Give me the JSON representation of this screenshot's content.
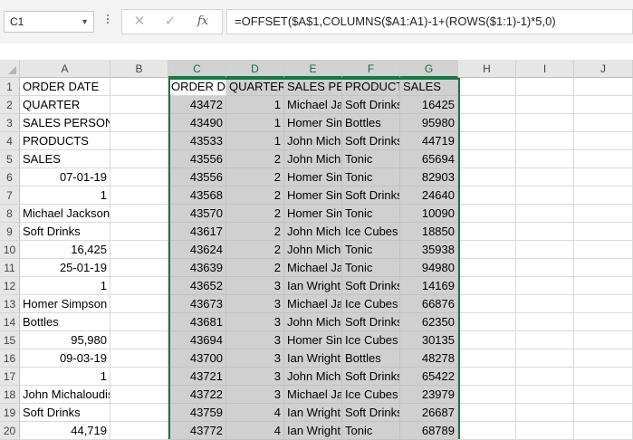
{
  "name_box": {
    "value": "C1"
  },
  "formula_bar": {
    "cancel_symbol": "✕",
    "enter_symbol": "✓",
    "fx_label": "fx",
    "formula": "=OFFSET($A$1,COLUMNS($A1:A1)-1+(ROWS($1:1)-1)*5,0)"
  },
  "columns": [
    "A",
    "B",
    "C",
    "D",
    "E",
    "F",
    "G",
    "H",
    "I",
    "J"
  ],
  "rows": [
    "1",
    "2",
    "3",
    "4",
    "5",
    "6",
    "7",
    "8",
    "9",
    "10",
    "11",
    "12",
    "13",
    "14",
    "15",
    "16",
    "17",
    "18",
    "19",
    "20"
  ],
  "grid": [
    [
      "ORDER DATE",
      "",
      "ORDER DATE",
      "QUARTER",
      "SALES PERSON",
      "PRODUCTS",
      "SALES"
    ],
    [
      "QUARTER",
      "",
      "43472",
      "1",
      "Michael Jackson",
      "Soft Drinks",
      "16425"
    ],
    [
      "SALES PERSON",
      "",
      "43490",
      "1",
      "Homer Simpson",
      "Bottles",
      "95980"
    ],
    [
      "PRODUCTS",
      "",
      "43533",
      "1",
      "John Michaloudis",
      "Soft Drinks",
      "44719"
    ],
    [
      "SALES",
      "",
      "43556",
      "2",
      "John Michaloudis",
      "Tonic",
      "65694"
    ],
    [
      "07-01-19",
      "",
      "43556",
      "2",
      "Homer Simpson",
      "Tonic",
      "82903"
    ],
    [
      "1",
      "",
      "43568",
      "2",
      "Homer Simpson",
      "Soft Drinks",
      "24640"
    ],
    [
      "Michael Jackson",
      "",
      "43570",
      "2",
      "Homer Simpson",
      "Tonic",
      "10090"
    ],
    [
      "Soft Drinks",
      "",
      "43617",
      "2",
      "John Michaloudis",
      "Ice Cubes",
      "18850"
    ],
    [
      "16,425",
      "",
      "43624",
      "2",
      "John Michaloudis",
      "Tonic",
      "35938"
    ],
    [
      "25-01-19",
      "",
      "43639",
      "2",
      "Michael Jackson",
      "Tonic",
      "94980"
    ],
    [
      "1",
      "",
      "43652",
      "3",
      "Ian Wright",
      "Soft Drinks",
      "14169"
    ],
    [
      "Homer Simpson",
      "",
      "43673",
      "3",
      "Michael Jackson",
      "Ice Cubes",
      "66876"
    ],
    [
      "Bottles",
      "",
      "43681",
      "3",
      "John Michaloudis",
      "Soft Drinks",
      "62350"
    ],
    [
      "95,980",
      "",
      "43694",
      "3",
      "Homer Simpson",
      "Ice Cubes",
      "30135"
    ],
    [
      "09-03-19",
      "",
      "43700",
      "3",
      "Ian Wright",
      "Bottles",
      "48278"
    ],
    [
      "1",
      "",
      "43721",
      "3",
      "John Michaloudis",
      "Soft Drinks",
      "65422"
    ],
    [
      "John Michaloudis",
      "",
      "43722",
      "3",
      "Michael Jackson",
      "Ice Cubes",
      "23979"
    ],
    [
      "Soft Drinks",
      "",
      "43759",
      "4",
      "Ian Wright",
      "Soft Drinks",
      "26687"
    ],
    [
      "44,719",
      "",
      "43772",
      "4",
      "Ian Wright",
      "Tonic",
      "68789"
    ]
  ]
}
